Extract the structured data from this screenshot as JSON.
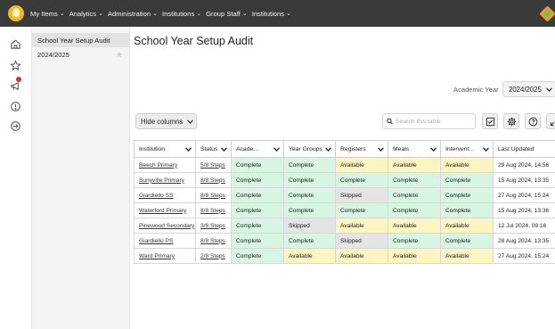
{
  "topnav": {
    "items": [
      {
        "label": "My Items",
        "chev": "⌄"
      },
      {
        "label": "Analytics",
        "chev": "⌄"
      },
      {
        "label": "Administration",
        "chev": "⌄"
      },
      {
        "label": "Institutions",
        "chev": "⌄"
      },
      {
        "label": "Group Staff",
        "chev": "⌄"
      },
      {
        "label": "Institutions",
        "chev": "⌄"
      }
    ]
  },
  "sidebar": {
    "items": [
      {
        "label": "School Year Setup Audit"
      },
      {
        "label": "2024/2025"
      }
    ]
  },
  "page": {
    "title": "School Year Setup Audit",
    "academic_year_label": "Academic Year",
    "academic_year_value": "2024/2025"
  },
  "toolbar": {
    "hide_columns_label": "Hide columns",
    "search_placeholder": "Search this table"
  },
  "table": {
    "columns": [
      "Institution",
      "Status",
      "Acade...",
      "Year Groups",
      "Registers",
      "Meals",
      "Intervent...",
      "Last Updated"
    ],
    "rows": [
      [
        "Beech Primary",
        "5/8 Steps",
        "Complete",
        "Complete",
        "Available",
        "Available",
        "Available",
        "29 Aug 2024, 14:56"
      ],
      [
        "Sunyville Primary",
        "8/8 Steps",
        "Complete",
        "Complete",
        "Complete",
        "Complete",
        "Complete",
        "15 Aug 2024, 13:35"
      ],
      [
        "Giardiello SS",
        "8/8 Steps",
        "Complete",
        "Complete",
        "Skipped",
        "Complete",
        "Complete",
        "27 Aug 2024, 15:24"
      ],
      [
        "Waterford Primary",
        "8/8 Steps",
        "Complete",
        "Complete",
        "Complete",
        "Complete",
        "Complete",
        "15 Aug 2024, 13:36"
      ],
      [
        "Pinewood Secondary",
        "3/8 Steps",
        "Complete",
        "Skipped",
        "Available",
        "Available",
        "Available",
        "12 Jul 2024, 09:16"
      ],
      [
        "Giardiello PS",
        "8/8 Steps",
        "Complete",
        "Complete",
        "Skipped",
        "Complete",
        "Complete",
        "28 Aug 2024, 13:35"
      ],
      [
        "Ward Primary",
        "2/8 Steps",
        "Complete",
        "Available",
        "Available",
        "Available",
        "Available",
        "27 Aug 2024, 15:24"
      ]
    ]
  },
  "colors": {
    "topbar": "#3a3a3a",
    "complete": "#d7f5e2",
    "available": "#fcf5c2",
    "skipped": "#e4e4e4",
    "notification": "#d0342c"
  },
  "icons": [
    "home-icon",
    "star-icon",
    "megaphone-icon",
    "alert-circle-icon",
    "sign-in-icon",
    "search-icon",
    "checkbox-icon",
    "gear-icon",
    "help-icon",
    "expand-icon"
  ]
}
